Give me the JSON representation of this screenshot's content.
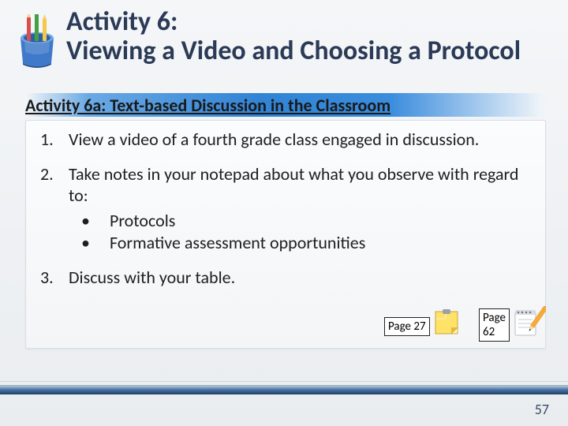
{
  "header": {
    "title_line1": "Activity 6:",
    "title_line2": "Viewing a Video and Choosing a Protocol",
    "icon": "pencil-cup-icon"
  },
  "subtitle": {
    "text": "Activity 6a: Text-based Discussion in the Classroom"
  },
  "list": {
    "item1": "View a video of a fourth grade class engaged in discussion.",
    "item2": "Take notes  in your notepad about what you observe with regard to:",
    "item2_sub1": "Protocols",
    "item2_sub2": "Formative assessment opportunities",
    "item3": "Discuss with your table."
  },
  "page_refs": {
    "ref1": "Page 27",
    "ref2": "Page 62"
  },
  "icons": {
    "sticky": "sticky-note-icon",
    "notepad": "notepad-pencil-icon"
  },
  "slide_number": "57"
}
